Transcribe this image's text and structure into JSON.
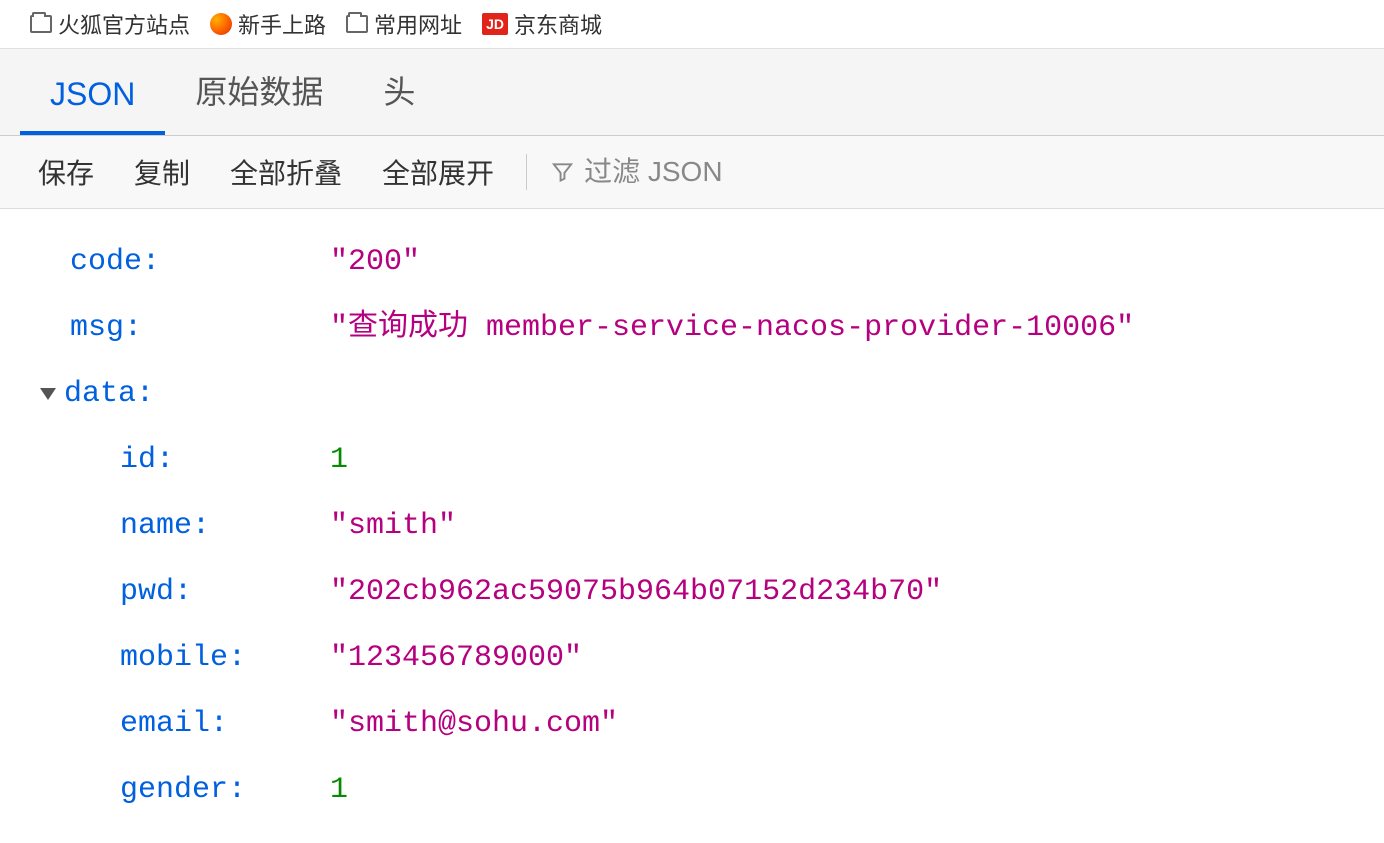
{
  "bookmarks": [
    {
      "label": "火狐官方站点",
      "icon": "folder"
    },
    {
      "label": "新手上路",
      "icon": "firefox"
    },
    {
      "label": "常用网址",
      "icon": "folder"
    },
    {
      "label": "京东商城",
      "icon": "jd",
      "iconText": "JD"
    }
  ],
  "tabs": [
    {
      "label": "JSON",
      "active": true
    },
    {
      "label": "原始数据",
      "active": false
    },
    {
      "label": "头",
      "active": false
    }
  ],
  "toolbar": {
    "save": "保存",
    "copy": "复制",
    "collapseAll": "全部折叠",
    "expandAll": "全部展开",
    "filterPlaceholder": "过滤 JSON"
  },
  "jsonData": {
    "rows": [
      {
        "key": "code:",
        "value": "\"200\"",
        "type": "string",
        "indent": 1
      },
      {
        "key": "msg:",
        "value": "\"查询成功 member-service-nacos-provider-10006\"",
        "type": "string",
        "indent": 1
      },
      {
        "key": "data:",
        "value": "",
        "type": "object",
        "indent": 1,
        "expandable": true
      },
      {
        "key": "id:",
        "value": "1",
        "type": "number",
        "indent": 2
      },
      {
        "key": "name:",
        "value": "\"smith\"",
        "type": "string",
        "indent": 2
      },
      {
        "key": "pwd:",
        "value": "\"202cb962ac59075b964b07152d234b70\"",
        "type": "string",
        "indent": 2
      },
      {
        "key": "mobile:",
        "value": "\"123456789000\"",
        "type": "string",
        "indent": 2
      },
      {
        "key": "email:",
        "value": "\"smith@sohu.com\"",
        "type": "string",
        "indent": 2
      },
      {
        "key": "gender:",
        "value": "1",
        "type": "number",
        "indent": 2
      }
    ]
  }
}
